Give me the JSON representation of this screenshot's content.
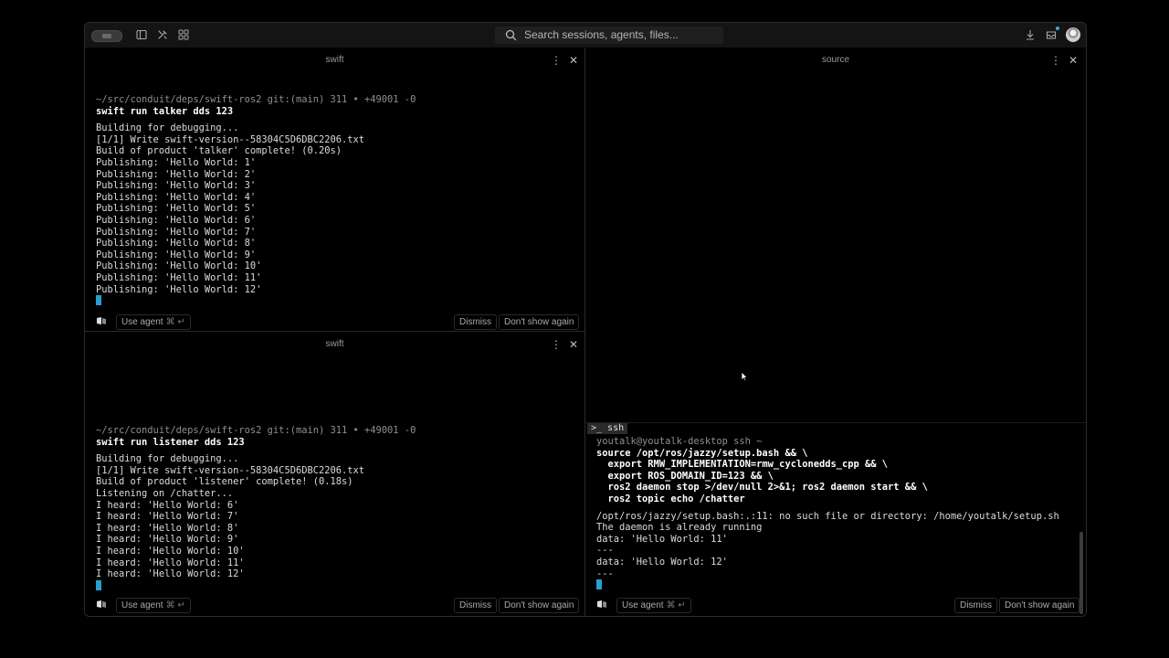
{
  "topbar": {
    "search_placeholder": "Search sessions, agents, files...",
    "icons": [
      "window-toggle-icon",
      "sidebar-icon",
      "tools-icon",
      "grid-icon",
      "download-icon",
      "inbox-icon",
      "avatar"
    ]
  },
  "panes": {
    "talker": {
      "title": "swift",
      "prompt": "~/src/conduit/deps/swift-ros2 git:(main) 311 • +49001 -0",
      "command": "swift run talker dds 123",
      "output": "Building for debugging...\n[1/1] Write swift-version--58304C5D6DBC2206.txt\nBuild of product 'talker' complete! (0.20s)\nPublishing: 'Hello World: 1'\nPublishing: 'Hello World: 2'\nPublishing: 'Hello World: 3'\nPublishing: 'Hello World: 4'\nPublishing: 'Hello World: 5'\nPublishing: 'Hello World: 6'\nPublishing: 'Hello World: 7'\nPublishing: 'Hello World: 8'\nPublishing: 'Hello World: 9'\nPublishing: 'Hello World: 10'\nPublishing: 'Hello World: 11'\nPublishing: 'Hello World: 12'"
    },
    "listener": {
      "title": "swift",
      "prompt": "~/src/conduit/deps/swift-ros2 git:(main) 311 • +49001 -0",
      "command": "swift run listener dds 123",
      "output": "Building for debugging...\n[1/1] Write swift-version--58304C5D6DBC2206.txt\nBuild of product 'listener' complete! (0.18s)\nListening on /chatter...\nI heard: 'Hello World: 6'\nI heard: 'Hello World: 7'\nI heard: 'Hello World: 8'\nI heard: 'Hello World: 9'\nI heard: 'Hello World: 10'\nI heard: 'Hello World: 11'\nI heard: 'Hello World: 12'"
    },
    "source": {
      "title": "source",
      "ssh_tab": ">_ ssh",
      "prompt": "youtalk@youtalk-desktop ssh ~",
      "command": "source /opt/ros/jazzy/setup.bash && \\\n  export RMW_IMPLEMENTATION=rmw_cyclonedds_cpp && \\\n  export ROS_DOMAIN_ID=123 && \\\n  ros2 daemon stop >/dev/null 2>&1; ros2 daemon start && \\\n  ros2 topic echo /chatter",
      "output": "/opt/ros/jazzy/setup.bash:.:11: no such file or directory: /home/youtalk/setup.sh\nThe daemon is already running\ndata: 'Hello World: 11'\n---\ndata: 'Hello World: 12'\n---"
    }
  },
  "footer": {
    "use_agent": "Use agent",
    "shortcut": "⌘ ↵",
    "dismiss": "Dismiss",
    "dont_show": "Don't show again"
  },
  "colors": {
    "accent": "#27a0cf",
    "background": "#000000"
  }
}
